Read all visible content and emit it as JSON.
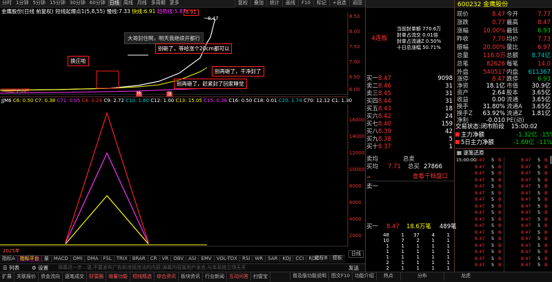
{
  "topbar": {
    "periods": [
      "分时",
      "1分钟",
      "5分钟",
      "15分钟",
      "30分钟",
      "60分钟",
      "日线",
      "周线",
      "月线",
      "多周期",
      "更多"
    ],
    "selected": "日线",
    "right_buttons": [
      "复权",
      "叠加",
      "统计",
      "画线",
      "F10",
      "标记",
      "+自选",
      "返回"
    ]
  },
  "ind_line": {
    "name": "金鹰股份(日线 前复权)",
    "label1": "短线起爆点1(5,8,55)",
    "label2": "慢线:",
    "v2": "7.33",
    "label3": "快线:",
    "v3": "6.91",
    "label4": "趋势线:",
    "v4": "5.87",
    "v5": "6.91"
  },
  "chart": {
    "high_mark": "8.47",
    "low_mark": "5.59",
    "yticks": [
      "8.50",
      "8.00",
      "7.50",
      "7.00",
      "6.50",
      "6.00"
    ],
    "marks": [
      "热",
      "涨"
    ]
  },
  "annotations": {
    "a1": "大哥封住啊，明天我继续开都行",
    "a2": "别砸了，等哈涨个20cm都可以",
    "a3": "别再砸了，干净封了",
    "a4": "别再砸了，赶紧封了回家睡觉",
    "a5": "换庄啦"
  },
  "order_info": {
    "lines": [
      "当前封单额 770.6万",
      "封单占流交 0.01倍",
      "封单占流通Z 0.50%",
      "十日总涨幅 50.71%"
    ],
    "lianban": "4连板"
  },
  "ind2": {
    "name": "JJM6",
    "items": [
      "C6: 0.50",
      "C7: 0.38",
      "C71: 0.05",
      "C8: 0.24",
      "C9: 2.72",
      "C10: 1.60",
      "C12: 1.00",
      "C13: 15.05",
      "C15: 0.38",
      "C16: 0.50",
      "C18: 0.01",
      "C20: 1.74",
      "C70: 12.12",
      "C1: 1.30"
    ],
    "yticks": [
      "16000",
      "14000",
      "12000",
      "10000",
      "8000",
      "6000",
      "4000",
      "2000"
    ],
    "year": "2025年"
  },
  "chart_data": {
    "type": "area",
    "x": [
      1,
      2,
      3
    ],
    "series": [
      {
        "name": "",
        "color": "#f22",
        "values": [
          400,
          16500,
          400
        ]
      },
      {
        "name": "",
        "color": "#f3f",
        "values": [
          300,
          11500,
          300
        ]
      },
      {
        "name": "",
        "color": "#ff0",
        "values": [
          200,
          6200,
          200
        ]
      }
    ],
    "ylim": [
      0,
      17000
    ]
  },
  "bottom_tabs": [
    "指标A",
    "指标平台",
    "量",
    "MACD",
    "DMI",
    "DMA",
    "FSL",
    "TRIX",
    "BRAR",
    "CR",
    "VR",
    "OBV",
    "ASI",
    "EMV",
    "VOL-TDX",
    "RSI",
    "WR",
    "SAR",
    "KDJ",
    "CCI",
    "ROC"
  ],
  "bottom_tabs_selected": "指标平台",
  "bottom_right": [
    "指标B",
    "模板"
  ],
  "footer": {
    "list_btn": "列表",
    "settings_btn": "设置",
    "notice": "弹幕进一步...语,不要发布广告和违规违法的内容,弹幕内容属用户发言,与本系统立场无关",
    "send": "发送",
    "daily": "日线"
  },
  "status": [
    "扩展",
    "关联报价",
    "资金流向",
    "逐笔成交",
    "财富圈",
    "熔量功能",
    "短线精选",
    "综合资讯",
    "板块资讯",
    "行业新闻",
    "互动问答",
    "扫雷宝"
  ],
  "status_right": [
    "普及版功能说明",
    "图文F10",
    "功能介绍",
    "热点",
    "分布",
    "龙虎"
  ],
  "stock": {
    "code": "600232",
    "name": "金鹰股份"
  },
  "quote": [
    {
      "l": "现价",
      "v": "8.47",
      "l2": "今开",
      "v2": "7.77"
    },
    {
      "l": "涨跌",
      "v": "0.77",
      "l2": "最高",
      "v2": "8.47"
    },
    {
      "l": "涨幅",
      "v": "10.00%",
      "l2": "最低",
      "v2": "6.93"
    },
    {
      "l": "昨收",
      "v": "7.70",
      "l2": "均价",
      "v2": "7.73"
    },
    {
      "l": "振幅",
      "v": "20.00%",
      "l2": "量比",
      "v2": "6.97"
    },
    {
      "l": "总量",
      "v": "116.0万",
      "l2": "总额",
      "v2": "8.74亿"
    },
    {
      "l": "总笔",
      "v": "82626",
      "l2": "每笔",
      "v2": "14.0"
    },
    {
      "l": "外盘",
      "v": "540517",
      "l2": "内盘",
      "v2": "611367"
    }
  ],
  "sells": [
    {
      "l": "卖十",
      "p": "8.47",
      "v": "9098"
    },
    {
      "l": "卖九",
      "p": "8.46",
      "v": "31"
    },
    {
      "l": "卖八",
      "p": "8.45",
      "v": "31"
    },
    {
      "l": "卖七",
      "p": "8.44",
      "v": "31"
    },
    {
      "l": "卖六",
      "p": "8.43",
      "v": "18"
    },
    {
      "l": "卖五",
      "p": "8.42",
      "v": "24"
    },
    {
      "l": "卖四",
      "p": "8.40",
      "v": "159"
    },
    {
      "l": "卖三",
      "p": "8.39",
      "v": "42"
    },
    {
      "l": "卖二",
      "p": "8.38",
      "v": "5"
    },
    {
      "l": "卖一",
      "p": "8.37",
      "v": "1"
    }
  ],
  "sells_disp": [
    {
      "l": "买一",
      "p": "8.47",
      "v": "9098"
    },
    {
      "l": "卖二",
      "p": "8.46",
      "v": "31"
    },
    {
      "l": "卖三",
      "p": "8.45",
      "v": "31"
    },
    {
      "l": "买四",
      "p": "8.44",
      "v": "31"
    },
    {
      "l": "买五",
      "p": "8.43",
      "v": "18"
    },
    {
      "l": "买六",
      "p": "8.42",
      "v": "24"
    },
    {
      "l": "买七",
      "p": "8.40",
      "v": "159"
    },
    {
      "l": "买八",
      "p": "8.39",
      "v": "42"
    },
    {
      "l": "买九",
      "p": "8.38",
      "v": "5"
    },
    {
      "l": "买十",
      "p": "8.37",
      "v": "1"
    }
  ],
  "total": {
    "l": "买均",
    "v": "7.71",
    "l2": "总买",
    "v2": "27866",
    "l0": "卖均",
    "l02": "总卖"
  },
  "see_more": "查看千档盘口",
  "sell1": {
    "l": "卖一"
  },
  "buy1": {
    "l": "买一",
    "p": "8.47",
    "q": "18.6万笔",
    "n": "489笔"
  },
  "queue": [
    [
      "48",
      "1",
      "37",
      "4",
      "1"
    ],
    [
      "10",
      "7",
      "2",
      "1",
      "1"
    ],
    [
      "1",
      "1",
      "1",
      "1",
      "1"
    ],
    [
      "1",
      "1",
      "1",
      "1",
      "1"
    ],
    [
      "1",
      "1",
      "1",
      "1",
      "1"
    ],
    [
      "2",
      "1",
      "1",
      "1",
      "1"
    ],
    [
      "2",
      "1",
      "1",
      "1",
      "1"
    ]
  ],
  "info": [
    {
      "l": "涨停",
      "v": "8.47",
      "l2": "跌停",
      "v2": "6.93"
    },
    {
      "l": "净资",
      "v": "18.1亿",
      "l2": "市值",
      "v2": "30.9亿"
    },
    {
      "l": "资产",
      "v": "2.64",
      "l2": "股本",
      "v2": "3.65亿"
    },
    {
      "l": "收益",
      "v": "0.00",
      "l2": "流通",
      "v2": "3.65亿"
    },
    {
      "l": "换手",
      "v": "31.80%",
      "l2": "流通A",
      "v2": "3.65亿"
    },
    {
      "l": "换手Z",
      "v": "63.92%",
      "l2": "流通Z",
      "v2": "1.81亿"
    },
    {
      "l": "净利",
      "v": "-0.010",
      "l2": "PE(动)",
      "v2": ""
    }
  ],
  "trade_status": {
    "l": "交易状态:",
    "v": "闭市阶段",
    "t": "15:00:02"
  },
  "fund": [
    {
      "l": "主力净额",
      "v": "-1.32亿",
      "p": "-15%"
    },
    {
      "l": "5日主力净额",
      "v": "-1.69亿",
      "p": "-11%"
    }
  ],
  "ticks_title": "逐笔还原",
  "ticks": [
    [
      "15:00:00",
      "8.47",
      "5",
      "B"
    ],
    [
      "",
      "8.47",
      "5",
      "B"
    ],
    [
      "",
      "8.47",
      "5",
      "B"
    ],
    [
      "",
      "8.47",
      "5",
      "B"
    ],
    [
      "",
      "8.47",
      "5",
      "B"
    ],
    [
      "",
      "8.47",
      "5",
      "B"
    ],
    [
      "",
      "8.47",
      "5",
      "B"
    ],
    [
      "",
      "8.47",
      "5",
      "B"
    ],
    [
      "",
      "8.47",
      "5",
      "B"
    ],
    [
      "",
      "8.47",
      "5",
      "B"
    ],
    [
      "",
      "8.47",
      "5",
      "B"
    ],
    [
      "",
      "8.47",
      "5",
      "B"
    ],
    [
      "",
      "8.47",
      "5",
      "B"
    ],
    [
      "",
      "8.47",
      "5",
      "B"
    ],
    [
      "",
      "8.47",
      "5",
      "B"
    ],
    [
      "",
      "8.47",
      "5",
      "B"
    ],
    [
      "",
      "8.47",
      "5",
      "B"
    ]
  ],
  "ticks2": [
    [
      "",
      "8.47",
      "5",
      "B"
    ],
    [
      "",
      "8.47",
      "5",
      "B"
    ],
    [
      "",
      "8.47",
      "5",
      "B"
    ],
    [
      "",
      "8.47",
      "5",
      "B"
    ],
    [
      "",
      "8.47",
      "5",
      "B"
    ],
    [
      "",
      "8.47",
      "5",
      "B"
    ],
    [
      "",
      "8.47",
      "5",
      "B"
    ],
    [
      "",
      "8.47",
      "5",
      "B"
    ],
    [
      "",
      "8.47",
      "5",
      "B"
    ],
    [
      "",
      "8.47",
      "5",
      "B"
    ],
    [
      "",
      "8.47",
      "5",
      "B"
    ],
    [
      "",
      "8.47",
      "5",
      "B"
    ],
    [
      "",
      "8.47",
      "5",
      "B"
    ],
    [
      "",
      "8.47",
      "5",
      "B"
    ],
    [
      "",
      "8.47",
      "5",
      "B"
    ],
    [
      "",
      "8.47",
      "5",
      "B"
    ],
    [
      "",
      "8.47",
      "5",
      "B"
    ]
  ]
}
